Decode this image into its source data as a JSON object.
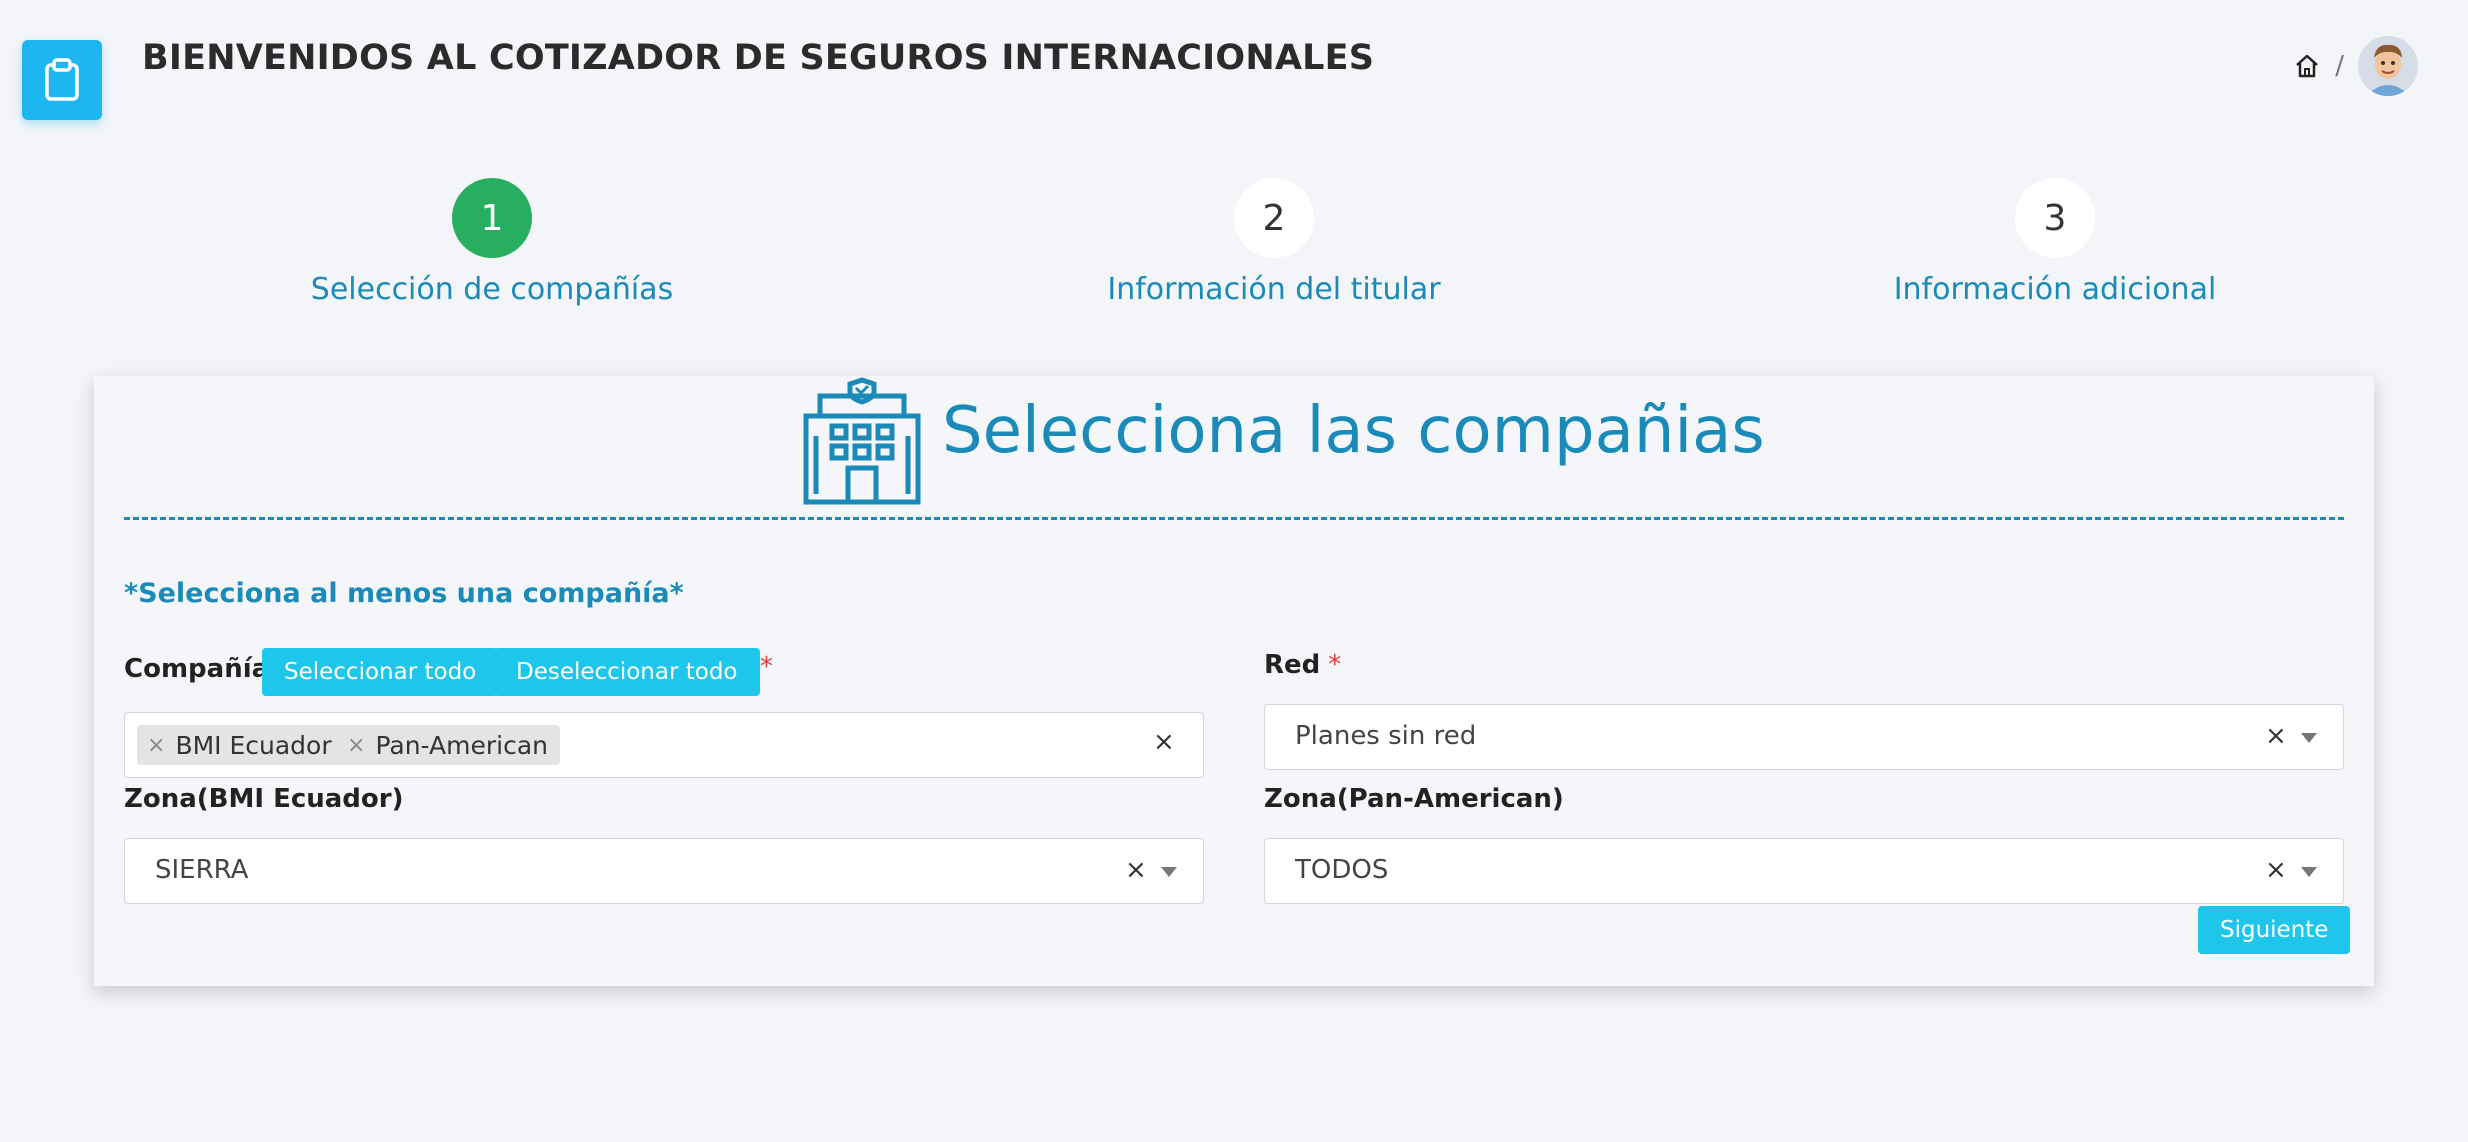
{
  "header": {
    "title": "BIENVENIDOS AL COTIZADOR DE SEGUROS INTERNACIONALES",
    "breadcrumb_sep": "/",
    "app_icon": "clipboard-icon",
    "home_icon": "home-icon"
  },
  "stepper": {
    "steps": [
      {
        "number": "1",
        "label": "Selección de compañías",
        "active": true
      },
      {
        "number": "2",
        "label": "Información del titular",
        "active": false
      },
      {
        "number": "3",
        "label": "Información adicional",
        "active": false
      }
    ]
  },
  "card": {
    "title": "Selecciona las compañias",
    "icon": "building-icon",
    "hint": "*Selecciona al menos una compañía*"
  },
  "form": {
    "companias": {
      "label": "Compañías",
      "select_all": "Seleccionar todo",
      "deselect_all": "Deseleccionar todo",
      "required_mark": "*",
      "tags": [
        "BMI Ecuador",
        "Pan-American"
      ],
      "clear": "×"
    },
    "red": {
      "label": "Red",
      "required_mark": "*",
      "value": "Planes sin red",
      "clear": "×"
    },
    "zona_bmi": {
      "label": "Zona(BMI Ecuador)",
      "value": "SIERRA",
      "clear": "×"
    },
    "zona_pan": {
      "label": "Zona(Pan-American)",
      "value": "TODOS",
      "clear": "×"
    },
    "next_button": "Siguiente"
  },
  "colors": {
    "accent": "#1a8bb8",
    "button": "#1ec6ec",
    "step_active": "#27ae60",
    "app_icon_bg": "#1eb6f0"
  }
}
